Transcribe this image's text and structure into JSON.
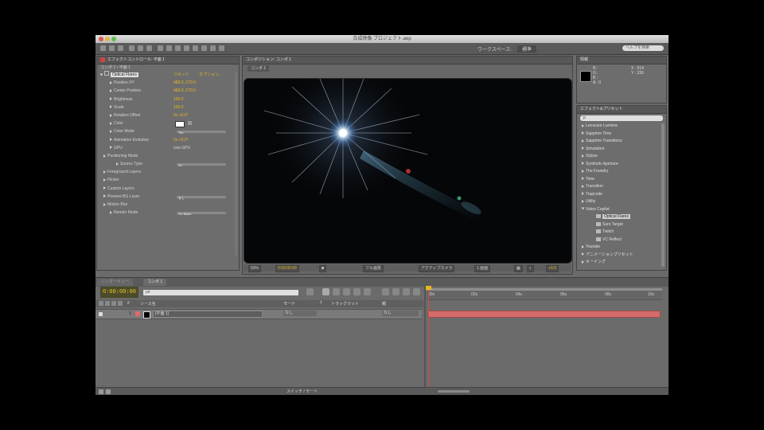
{
  "window": {
    "title": "合成映像 プロジェクト.aep",
    "accent": "#e6b81d",
    "timeline_bar_color": "#d46b6b"
  },
  "toolbar": {
    "workspace_label": "ワークスペース:",
    "workspace_value": "標準",
    "search_placeholder": "ヘルプを検索"
  },
  "effect_controls": {
    "tab": "エフェクトコントロール: 平面 1",
    "header": "コンポ 1 • 平面 1",
    "effect_name": "Optical Flares",
    "reset_label": "リセット",
    "options_label": "オプション...",
    "properties": [
      {
        "name": "Position XY",
        "value": "480.0, 270.0",
        "kind": "value",
        "indent": 1
      },
      {
        "name": "Center Position",
        "value": "480.0, 270.0",
        "kind": "value",
        "indent": 1
      },
      {
        "name": "Brightness",
        "value": "100.0",
        "kind": "value",
        "indent": 1
      },
      {
        "name": "Scale",
        "value": "100.0",
        "kind": "value",
        "indent": 1
      },
      {
        "name": "Rotation Offset",
        "value": "0x +0.0°",
        "kind": "value",
        "indent": 1
      },
      {
        "name": "Color",
        "value": "",
        "kind": "color",
        "indent": 1
      },
      {
        "name": "Color Mode",
        "value": "Tint",
        "kind": "slider",
        "indent": 1
      },
      {
        "name": "Animation Evolution",
        "value": "0x +0.0°",
        "kind": "value",
        "indent": 1
      },
      {
        "name": "GPU",
        "value": "Use GPU",
        "kind": "check",
        "indent": 1
      },
      {
        "name": "Positioning Mode",
        "value": "",
        "kind": "group",
        "indent": 0
      },
      {
        "name": "Source Type",
        "value": "2D",
        "kind": "slider",
        "indent": 2
      },
      {
        "name": "Foreground Layers",
        "value": "",
        "kind": "group",
        "indent": 0
      },
      {
        "name": "Flicker",
        "value": "",
        "kind": "group",
        "indent": 0
      },
      {
        "name": "Custom Layers",
        "value": "",
        "kind": "group",
        "indent": 0
      },
      {
        "name": "Preview BG Layer",
        "value": "なし",
        "kind": "slider",
        "indent": 0
      },
      {
        "name": "Motion Blur",
        "value": "",
        "kind": "group",
        "indent": 0
      },
      {
        "name": "Render Mode",
        "value": "On Black",
        "kind": "slider",
        "indent": 1
      }
    ]
  },
  "composition": {
    "tab": "コンポジション: コンポ 1",
    "sub_tab": "コンポ 1",
    "viewer_bar": {
      "zoom": "50%",
      "time": "0:00:00:00",
      "resolution": "フル画質",
      "camera": "アクティブカメラ",
      "views": "1 画面",
      "exposure": "+0.0"
    }
  },
  "info_panel": {
    "tab": "情報",
    "r": "R : ",
    "g": "G : ",
    "b": "B : ",
    "a": "A : 0",
    "x": "X : 514",
    "y": "Y : 230"
  },
  "effects_presets": {
    "tab": "エフェクト&プリセット",
    "search_value": "p",
    "items": [
      {
        "label": "Lenscare Lumiere",
        "level": 0
      },
      {
        "label": "Sapphire Time",
        "level": 0
      },
      {
        "label": "Sapphire Transitions",
        "level": 0
      },
      {
        "label": "Simulation",
        "level": 0
      },
      {
        "label": "Stylize",
        "level": 0
      },
      {
        "label": "Synthetic Aperture",
        "level": 0
      },
      {
        "label": "The Foundry",
        "level": 0
      },
      {
        "label": "Time",
        "level": 0
      },
      {
        "label": "Transition",
        "level": 0
      },
      {
        "label": "Trapcode",
        "level": 0
      },
      {
        "label": "Utility",
        "level": 0
      },
      {
        "label": "Video Copilot",
        "level": 0
      },
      {
        "label": "Optical Flares",
        "level": 1,
        "selected": true
      },
      {
        "label": "Sure Target",
        "level": 1
      },
      {
        "label": "Twitch",
        "level": 1
      },
      {
        "label": "VC Reflect",
        "level": 1
      },
      {
        "label": "Youtube",
        "level": 0
      },
      {
        "label": "アニメーションプリセット",
        "level": 0
      },
      {
        "label": "キーイング",
        "level": 0
      }
    ]
  },
  "timeline": {
    "tabs": [
      "レンダーキュー",
      "コンポ 1"
    ],
    "timecode": "0:00:00:00",
    "search_placeholder": "ρ▾",
    "ruler_labels": [
      "00s",
      "02s",
      "04s",
      "06s",
      "08s",
      "10s"
    ],
    "layer": {
      "index": "1",
      "name": "[平面 1]",
      "mode": "なし",
      "parent": "なし"
    },
    "columns": [
      "#",
      "ソース名",
      "モード",
      "T",
      "トラックマット",
      "親"
    ]
  },
  "bottom": {
    "toggle": "スイッチ / モード"
  }
}
